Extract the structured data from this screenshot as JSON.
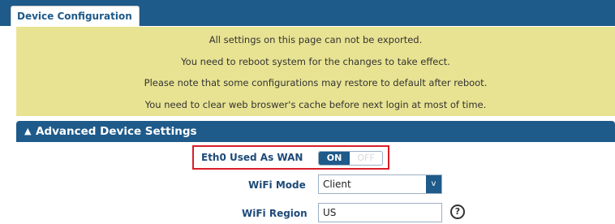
{
  "tabs": [
    {
      "label": "Device Configuration",
      "active": true
    }
  ],
  "notice": {
    "lines": [
      "All settings on this page can not be exported.",
      "You need to reboot system for the changes to take effect.",
      "Please note that some configurations may restore to default after reboot.",
      "You need to clear web broswer's cache before next login at most of time."
    ]
  },
  "section": {
    "title": "Advanced Device Settings",
    "collapse_icon": "chevron-up-icon"
  },
  "fields": {
    "eth0_wan": {
      "label": "Eth0 Used As WAN",
      "on_label": "ON",
      "off_label": "OFF",
      "value": "ON"
    },
    "wifi_mode": {
      "label": "WiFi Mode",
      "value": "Client",
      "arrow": "v"
    },
    "wifi_region": {
      "label": "WiFi Region",
      "value": "US",
      "help": "?"
    }
  },
  "colors": {
    "header_blue": "#1e5a8a",
    "notice_yellow": "#e8e392",
    "highlight_red": "#d81e2a"
  }
}
